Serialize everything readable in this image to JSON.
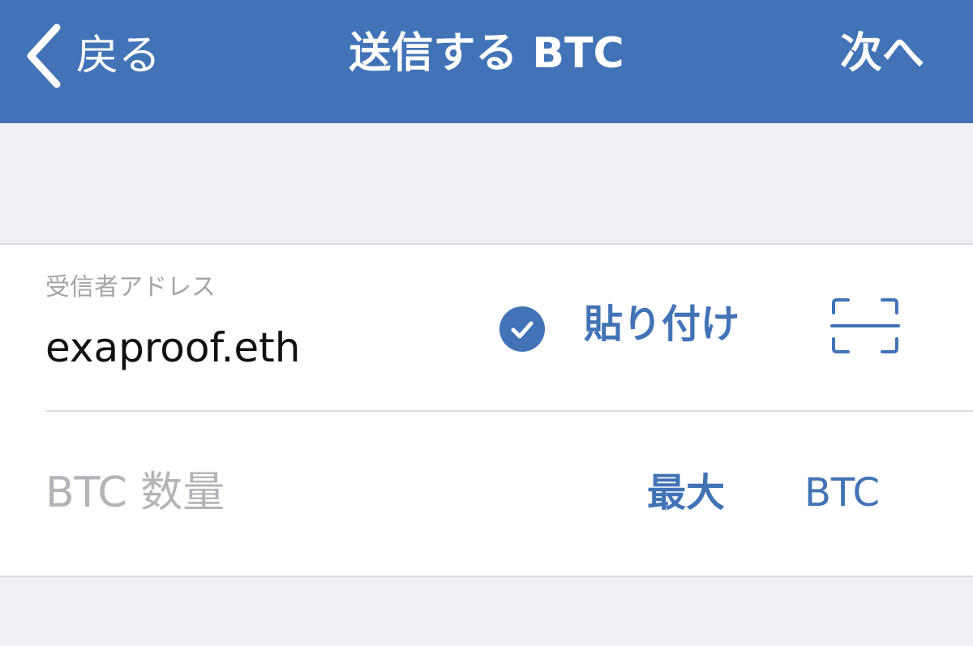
{
  "nav": {
    "back_label": "戻る",
    "back_icon": "chevron-left-icon",
    "title": "送信する BTC",
    "next_label": "次へ",
    "background": "#4273b6"
  },
  "recipient": {
    "label": "受信者アドレス",
    "value": "exaproof.eth",
    "verified_icon": "check-circle-icon",
    "paste_label": "貼り付け",
    "scan_icon": "qr-scan-icon"
  },
  "amount": {
    "placeholder": "BTC 数量",
    "max_label": "最大",
    "unit_label": "BTC"
  },
  "colors": {
    "accent": "#4273b6",
    "background": "#efeff4",
    "placeholder": "#b4b4b8",
    "label": "#a4a4a8"
  }
}
